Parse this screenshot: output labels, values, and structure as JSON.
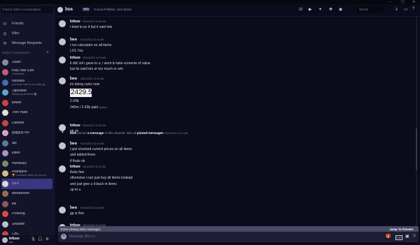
{
  "window": {
    "icon": "app-icon",
    "min": "–",
    "max": "▢",
    "close": "✕"
  },
  "sidebar": {
    "search_placeholder": "Find or start a conversation",
    "nav": [
      {
        "label": "Friends",
        "icon": "friends-icon",
        "glyph": "☏"
      },
      {
        "label": "Nitro",
        "icon": "nitro-icon",
        "glyph": "◎"
      },
      {
        "label": "Message Requests",
        "icon": "envelope-icon",
        "glyph": "✉"
      }
    ],
    "dm_header": "DIRECT MESSAGES",
    "dm_plus": "+",
    "dms": [
      {
        "name": "Justin",
        "sub": "",
        "color": "#8a8a9a"
      },
      {
        "name": "Kitty cats GIM",
        "sub": "4 Members",
        "color": "#c65a7a"
      },
      {
        "name": "Noodlex",
        "sub": "you never have to do today ag...",
        "color": "#4a6aa8"
      },
      {
        "name": "TapWater",
        "sub": "Streaming Roadsite 🅱",
        "color": "#5aa8c8"
      },
      {
        "name": "power",
        "sub": "",
        "color": "#d04040"
      },
      {
        "name": "Tren Hard",
        "sub": "",
        "color": "#e0e0e0"
      },
      {
        "name": "Duhdee",
        "sub": "",
        "color": "#c04848"
      },
      {
        "name": "gugguy789",
        "sub": "",
        "color": "#e2a0c0"
      },
      {
        "name": "api",
        "sub": "",
        "color": "#5a7a9a"
      },
      {
        "name": "kitten",
        "sub": "",
        "color": "#b090c0"
      },
      {
        "name": "Humbully",
        "sub": "",
        "color": "#7a8a6a"
      },
      {
        "name": "champion",
        "sub": "🏆 Constantly baby can you co...",
        "color": "#d0c080"
      },
      {
        "name": "ঠঙঙ",
        "sub": "",
        "color": "#d8d8e0"
      },
      {
        "name": "Meeeeeeet",
        "sub": "",
        "color": "#a06a50"
      },
      {
        "name": "trill",
        "sub": "",
        "color": "#8a5a5a"
      },
      {
        "name": "Prefiring",
        "sub": "",
        "color": "#d84a4a"
      },
      {
        "name": "Shadow",
        "sub": "",
        "color": "#c0c0c8"
      },
      {
        "name": "CBC",
        "sub": "",
        "color": "#d04040"
      }
    ],
    "active_dm_index": 12,
    "user": {
      "name": "Infuse",
      "status": "Idle",
      "mic": "🎙",
      "headset": "🎧",
      "settings": "⚙"
    }
  },
  "topbar": {
    "title": "ঠঙঙ",
    "tag": "ANA",
    "status": "Cocoa Pebbles, Sun Stone",
    "icons": [
      {
        "name": "call-icon",
        "glyph": "☏"
      },
      {
        "name": "video-icon",
        "glyph": "▶"
      },
      {
        "name": "pin-icon",
        "glyph": "✦"
      },
      {
        "name": "add-member-icon",
        "glyph": "✚"
      },
      {
        "name": "profile-icon",
        "glyph": "◉"
      }
    ],
    "search_placeholder": "Search",
    "right_icons": [
      {
        "name": "download-icon",
        "glyph": "⤓"
      },
      {
        "name": "inbox-icon",
        "glyph": "▭"
      },
      {
        "name": "help-icon",
        "glyph": "?"
      }
    ]
  },
  "messages": [
    {
      "author": "Infuse",
      "time": "05/24/2022 12:28 AM",
      "lines": [
        "i tried to pc it but it said lots"
      ]
    },
    {
      "author": "ঠঙঙ",
      "time": "05/24/2022 12:28 AM",
      "lines": [
        "i run calculator on all items",
        "LOL f ku"
      ]
    },
    {
      "author": "Infuse",
      "time": "05/24/2022 12:29 AM",
      "lines": [
        "it did..b4 i gave to u, i went to take screenie of value",
        "but its said lots or too much or w/e"
      ]
    },
    {
      "author": "ঠঙঙ",
      "time": "05/24/2022 12:29 AM",
      "lines": [
        "im doing calcs now"
      ],
      "big_value": "2429.5",
      "after": [
        "2.43b",
        "240m / 2.43b paid"
      ],
      "edited": "(edited)"
    },
    {
      "author": "Infuse",
      "time": "05/24/2022 12:33 AM",
      "lines": [
        "ok ok"
      ]
    },
    {
      "author": "ঠঙঙ",
      "time": "05/24/2022 12:33 AM",
      "lines": [
        "i just checked current prices on all items",
        "and added them",
        "if thats ok"
      ]
    },
    {
      "author": "Infuse",
      "time": "05/24/2022 12:33 AM",
      "lines": [
        "thats fine",
        "otherwise i can just buy all items instead",
        "and just give u it back in items",
        "up to u"
      ]
    },
    {
      "author": "ঠঙঙ",
      "time": "05/24/2022 12:33 AM",
      "lines": [
        "gp is fine"
      ]
    },
    {
      "author": "Infuse",
      "time": "05/24/2022 12:33 AM",
      "lines": []
    }
  ],
  "pinned": {
    "actor": "ঠঙঙ",
    "pre": "pinned",
    "link": "a message",
    "mid": "to this channel. See all",
    "link2": "pinned messages",
    "time": "05/24/2022 12:32 AM"
  },
  "older_bar": {
    "left": "You're viewing older messages",
    "right": "Jump To Present"
  },
  "composer": {
    "placeholder": "Message @ঠঙঙ",
    "icons": [
      {
        "name": "gift-icon",
        "glyph": "🎁"
      },
      {
        "name": "gif-icon",
        "glyph": "GIF"
      },
      {
        "name": "sticker-icon",
        "glyph": "▣"
      },
      {
        "name": "emoji-icon",
        "glyph": "☺"
      }
    ]
  }
}
